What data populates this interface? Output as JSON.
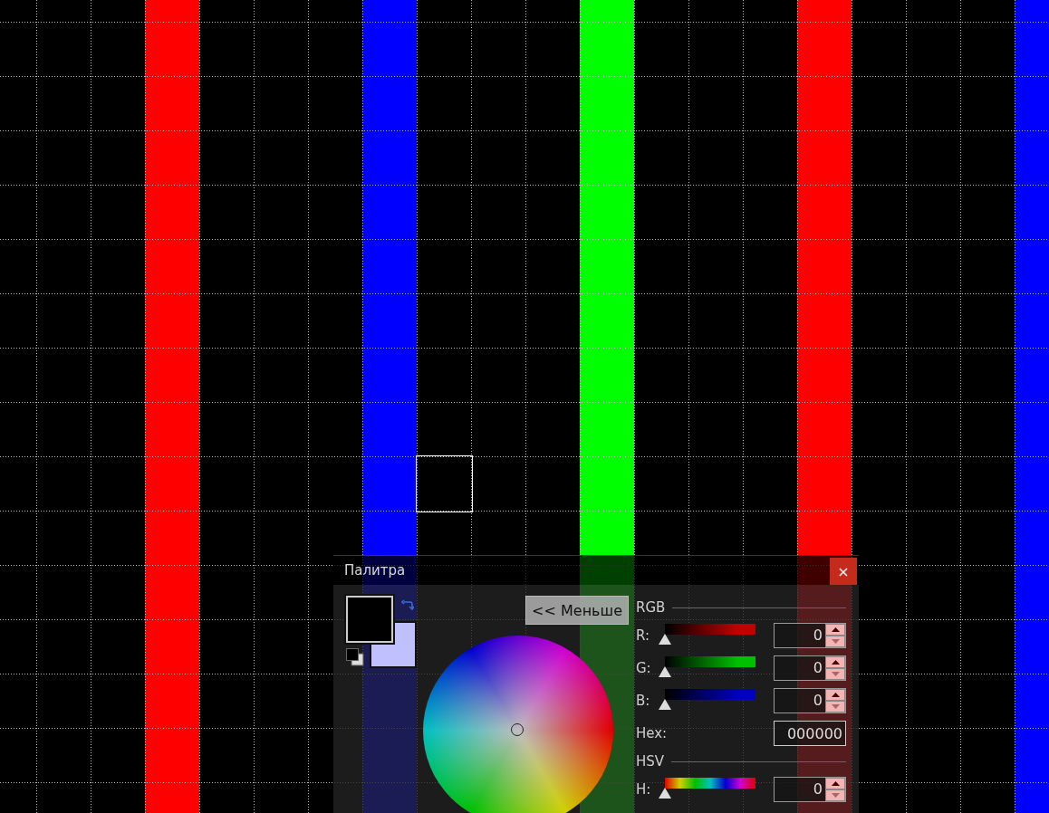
{
  "palette": {
    "title": "Палитра",
    "close": "×",
    "toggle": "<< Меньше",
    "swatches": [
      {
        "kind": "primary",
        "color": "#000000"
      },
      {
        "kind": "secondary",
        "color": "#c0c0ff"
      }
    ],
    "sections": [
      {
        "title": "RGB",
        "rows": [
          {
            "kind": "slider",
            "label": "R:",
            "color": "#c00000",
            "level": 0,
            "value": "0"
          },
          {
            "kind": "slider",
            "label": "G:",
            "color": "#00c000",
            "level": 0,
            "value": "0"
          },
          {
            "kind": "slider",
            "label": "B:",
            "color": "#0000c0",
            "level": 0,
            "value": "0"
          },
          {
            "kind": "text",
            "label": "Hex:",
            "value": "000000"
          }
        ]
      },
      {
        "title": "HSV",
        "rows": [
          {
            "kind": "hue",
            "label": "H:",
            "level": 0,
            "value": "0"
          }
        ]
      }
    ]
  }
}
